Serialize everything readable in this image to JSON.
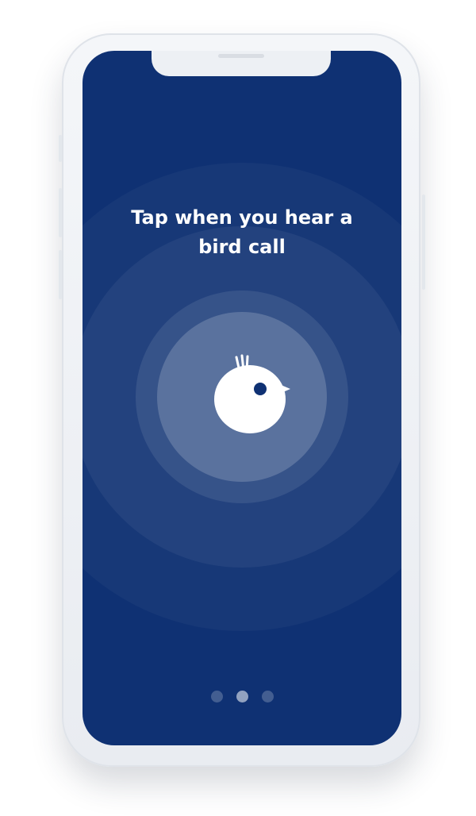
{
  "onboarding": {
    "title_line1": "Tap when you hear a",
    "title_line2": "bird call",
    "icon": "bird-icon",
    "pager": {
      "total": 3,
      "active_index": 1
    }
  },
  "colors": {
    "screen_background": "#0f3173",
    "phone_body": "#eef1f5",
    "text": "#ffffff"
  }
}
